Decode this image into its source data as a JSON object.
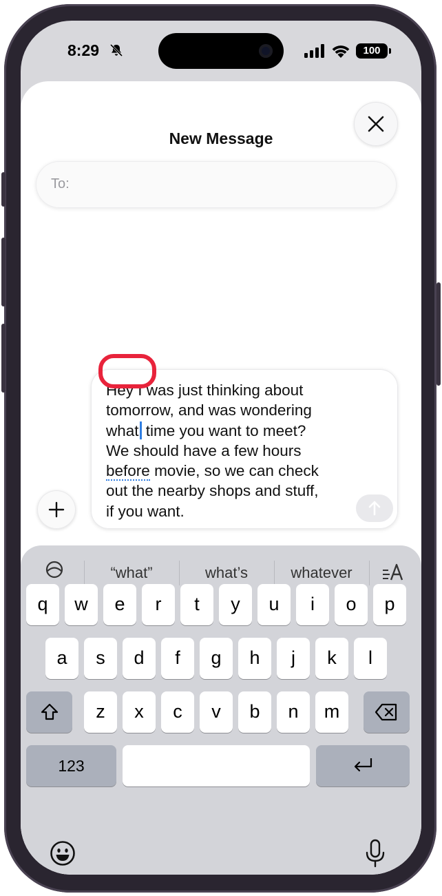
{
  "status_bar": {
    "time": "8:29",
    "battery": "100"
  },
  "header": {
    "title": "New Message"
  },
  "to_field": {
    "label": "To:"
  },
  "message": {
    "lines": [
      "Hey I was just thinking about",
      "tomorrow, and was wondering",
      "what time you want to meet?",
      "We should have a few hours",
      "before movie, so we can check",
      "out the nearby shops and stuff,",
      "if you want."
    ],
    "line3_word": "what",
    "line3_rest": " time you want to meet?",
    "line5_word": "before",
    "line5_rest": " movie, so we can check"
  },
  "predictions": [
    "“what”",
    "what’s",
    "whatever"
  ],
  "keyboard": {
    "row1": [
      "q",
      "w",
      "e",
      "r",
      "t",
      "y",
      "u",
      "i",
      "o",
      "p"
    ],
    "row2": [
      "a",
      "s",
      "d",
      "f",
      "g",
      "h",
      "j",
      "k",
      "l"
    ],
    "row3": [
      "z",
      "x",
      "c",
      "v",
      "b",
      "n",
      "m"
    ],
    "numbers_key": "123"
  },
  "colors": {
    "highlight": "#e8233b",
    "accent": "#2f7de1"
  },
  "icons": [
    "bell-slash-icon",
    "signal-icon",
    "wifi-icon",
    "close-icon",
    "plus-icon",
    "send-arrow-icon",
    "emoji-toggle-icon",
    "text-format-icon",
    "shift-icon",
    "delete-icon",
    "return-icon",
    "emoji-icon",
    "microphone-icon"
  ]
}
